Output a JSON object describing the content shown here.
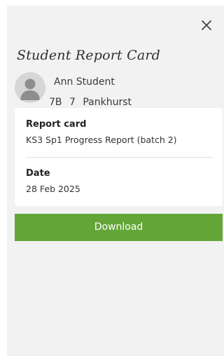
{
  "dialog": {
    "title": "Student Report Card",
    "close_icon": "close-icon"
  },
  "student": {
    "name": "Ann Student",
    "year": "7B",
    "form": "7",
    "house": "Pankhurst",
    "avatar_icon": "person-silhouette-icon"
  },
  "details": {
    "report_card_label": "Report card",
    "report_card_value": "KS3 Sp1 Progress Report (batch 2)",
    "date_label": "Date",
    "date_value": "28 Feb 2025"
  },
  "actions": {
    "download_label": "Download"
  },
  "colors": {
    "panel_bg": "#f2f2f2",
    "card_bg": "#ffffff",
    "download_bg": "#63a637",
    "avatar_bg": "#d6d6d6"
  }
}
